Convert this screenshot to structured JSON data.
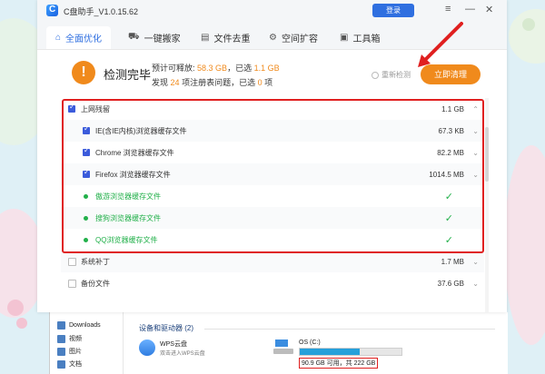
{
  "app": {
    "title": "C盘助手_V1.0.15.62",
    "login_label": "登录",
    "menu_icon": "≡",
    "min_icon": "—",
    "close_icon": "✕"
  },
  "tabs": [
    {
      "label": "全面优化",
      "icon": "⌂",
      "active": true
    },
    {
      "label": "一键搬家",
      "icon": "⛟",
      "active": false
    },
    {
      "label": "文件去重",
      "icon": "▤",
      "active": false
    },
    {
      "label": "空间扩容",
      "icon": "⚙",
      "active": false
    },
    {
      "label": "工具箱",
      "icon": "▣",
      "active": false
    }
  ],
  "status": {
    "icon": "!",
    "title": "检测完毕",
    "line1": {
      "prefix": "预计可释放:",
      "release": "58.3 GB",
      "mid": "，已选",
      "selected": "1.1 GB"
    },
    "line2": {
      "prefix": "发现",
      "count": "24",
      "mid": "项注册表问题，已选",
      "selected": "0",
      "suffix": "项"
    },
    "rescan_label": "重新检测",
    "clean_label": "立即清理"
  },
  "rows": [
    {
      "label": "上网残留",
      "size": "1.1 GB",
      "kind": "checked",
      "indent": 0,
      "chevron": "⌃"
    },
    {
      "label": "IE(含IE内核)浏览器缓存文件",
      "size": "67.3 KB",
      "kind": "checked",
      "indent": 1,
      "chevron": "⌄"
    },
    {
      "label": "Chrome 浏览器缓存文件",
      "size": "82.2 MB",
      "kind": "checked",
      "indent": 1,
      "chevron": "⌄"
    },
    {
      "label": "Firefox 浏览器缓存文件",
      "size": "1014.5 MB",
      "kind": "checked",
      "indent": 1,
      "chevron": "⌄"
    },
    {
      "label": "傲游浏览器缓存文件",
      "size": "",
      "kind": "done",
      "indent": 1,
      "chevron": "",
      "tick": "✓"
    },
    {
      "label": "搜狗浏览器缓存文件",
      "size": "",
      "kind": "done",
      "indent": 1,
      "chevron": "",
      "tick": "✓"
    },
    {
      "label": "QQ浏览器缓存文件",
      "size": "",
      "kind": "done",
      "indent": 1,
      "chevron": "",
      "tick": "✓"
    },
    {
      "label": "系统补丁",
      "size": "1.7 MB",
      "kind": "empty",
      "indent": 0,
      "chevron": "⌄"
    },
    {
      "label": "备份文件",
      "size": "37.6 GB",
      "kind": "empty",
      "indent": 0,
      "chevron": "⌄"
    }
  ],
  "explorer": {
    "nav": [
      {
        "label": "Downloads",
        "icon": "download-icon"
      },
      {
        "label": "视频",
        "icon": "video-icon"
      },
      {
        "label": "图片",
        "icon": "image-icon"
      },
      {
        "label": "文档",
        "icon": "document-icon"
      }
    ],
    "section_title": "设备和驱动器 (2)",
    "wps": {
      "name": "WPS云盘",
      "sub": "双击进入WPS云盘"
    },
    "drive": {
      "name": "OS (C:)",
      "capacity": "90.9 GB 可用，共 222 GB",
      "used_fraction": 0.59
    }
  }
}
